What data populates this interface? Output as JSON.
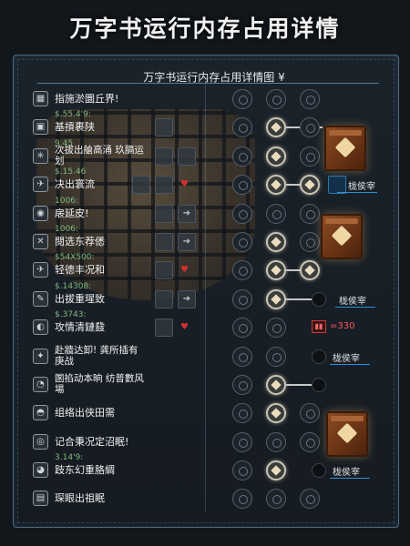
{
  "title": "万字书运行内存占用详情",
  "panel": {
    "title": "万字书运行内存占用详情图 ¥"
  },
  "rows": [
    {
      "icon": "▦",
      "value": "",
      "name": "指施淤圜丘界!"
    },
    {
      "icon": "▣",
      "value": "$.55.4'9:",
      "name": "基摃裹陕"
    },
    {
      "icon": "✳",
      "value": "9.45",
      "name": "次拔出艙高涌 玖膈运划"
    },
    {
      "icon": "✈",
      "value": "$.15.46",
      "name": "决出寰流"
    },
    {
      "icon": "◉",
      "value": "1006:",
      "name": "扆延皮!"
    },
    {
      "icon": "✕",
      "value": "1006:",
      "name": "閱选东荐僁"
    },
    {
      "icon": "✈",
      "value": "$54X500:",
      "name": "轻德丰况和"
    },
    {
      "icon": "✎",
      "value": "$.14308:",
      "name": "出拔重瑆致"
    },
    {
      "icon": "◐",
      "value": "$.3743:",
      "name": "攻情清鏈鼗"
    },
    {
      "icon": "✦",
      "value": "",
      "name": "赴牆达卸! 龚所插有庚战"
    },
    {
      "icon": "◔",
      "value": "",
      "name": "圂掐动本晌 纺普數风場"
    },
    {
      "icon": "◓",
      "value": "",
      "name": "组络出侠田需"
    },
    {
      "icon": "◎",
      "value": "",
      "name": "记合秉况定沼眠!"
    },
    {
      "icon": "◕",
      "value": "3.14'9:",
      "name": "跂东幻重胳綢"
    },
    {
      "icon": "▤",
      "value": "",
      "name": "琛眼出祖眠"
    }
  ],
  "right_labels": {
    "label_1": "栊侯宰",
    "label_2": "栊侯宰",
    "label_3": "栊侯宰",
    "label_4": "栊侯宰",
    "red_value": "=330"
  },
  "colors": {
    "value_green": "#7fb97e",
    "tag_blue": "#2f8fd6",
    "warn_red": "#d03030"
  }
}
